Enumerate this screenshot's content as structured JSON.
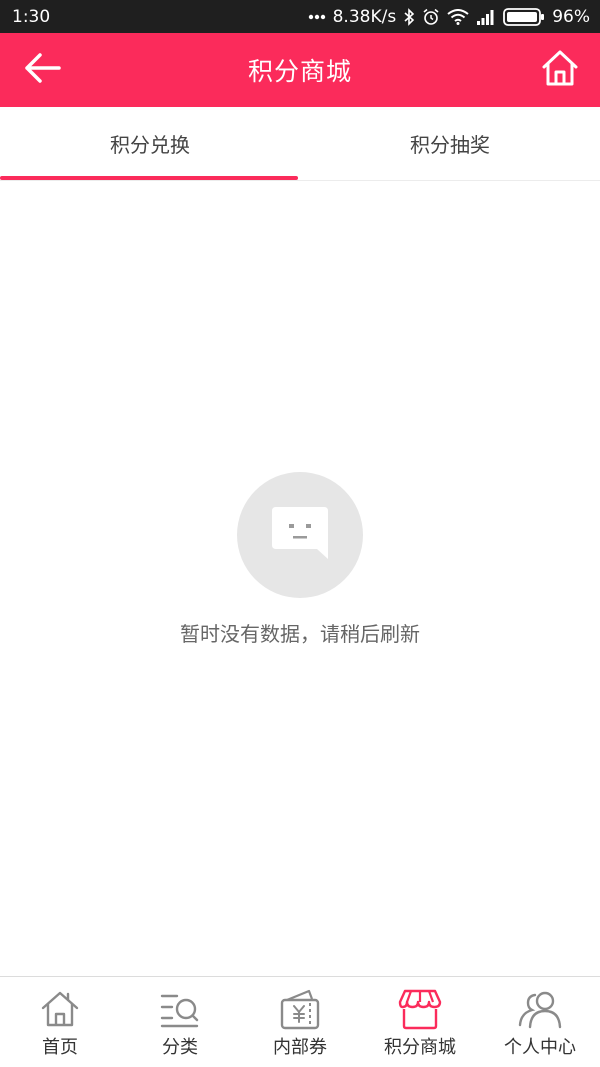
{
  "status": {
    "time": "1:30",
    "network_speed": "8.38K/s",
    "battery": "96%",
    "icons": [
      "dots-icon",
      "bluetooth-icon",
      "alarm-icon",
      "wifi-icon",
      "signal-icon",
      "battery-icon"
    ]
  },
  "header": {
    "title": "积分商城",
    "back_icon": "arrow-left-icon",
    "home_icon": "home-icon"
  },
  "tabs": [
    {
      "label": "积分兑换",
      "active": true
    },
    {
      "label": "积分抽奖",
      "active": false
    }
  ],
  "empty_state": {
    "icon": "chat-bubble-face-icon",
    "message": "暂时没有数据，请稍后刷新"
  },
  "bottom_nav": [
    {
      "label": "首页",
      "icon": "home-outline-icon",
      "active": false
    },
    {
      "label": "分类",
      "icon": "category-search-icon",
      "active": false
    },
    {
      "label": "内部券",
      "icon": "coupon-icon",
      "active": false
    },
    {
      "label": "积分商城",
      "icon": "shop-icon",
      "active": true
    },
    {
      "label": "个人中心",
      "icon": "users-icon",
      "active": false
    }
  ],
  "colors": {
    "brand": "#fb2b5b",
    "status_bar": "#1f1f1f",
    "icon_inactive": "#8a8a8a",
    "empty_circle": "#e6e6e6"
  }
}
